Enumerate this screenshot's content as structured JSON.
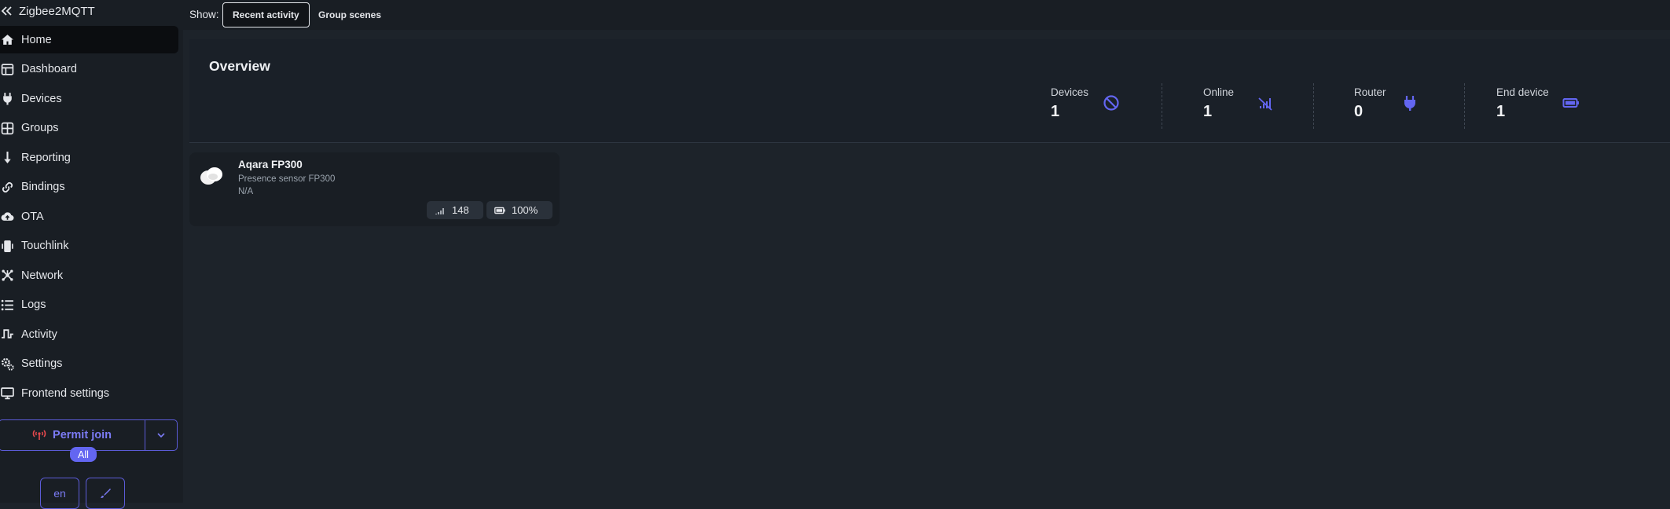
{
  "app": {
    "title": "Zigbee2MQTT"
  },
  "sidebar": {
    "items": [
      {
        "label": "Home",
        "icon": "home-icon",
        "active": true
      },
      {
        "label": "Dashboard",
        "icon": "dashboard-icon"
      },
      {
        "label": "Devices",
        "icon": "plug-icon"
      },
      {
        "label": "Groups",
        "icon": "groups-icon"
      },
      {
        "label": "Reporting",
        "icon": "arrow-down-icon"
      },
      {
        "label": "Bindings",
        "icon": "link-icon"
      },
      {
        "label": "OTA",
        "icon": "cloud-upload-icon"
      },
      {
        "label": "Touchlink",
        "icon": "touchlink-icon"
      },
      {
        "label": "Network",
        "icon": "network-icon"
      },
      {
        "label": "Logs",
        "icon": "list-icon"
      },
      {
        "label": "Activity",
        "icon": "activity-icon"
      },
      {
        "label": "Settings",
        "icon": "gears-icon"
      },
      {
        "label": "Frontend settings",
        "icon": "monitor-icon"
      }
    ],
    "permit_join": {
      "label": "Permit join",
      "badge": "All"
    },
    "language": "en"
  },
  "topbar": {
    "show_label": "Show:",
    "tabs": [
      {
        "label": "Recent activity",
        "selected": true
      },
      {
        "label": "Group scenes",
        "selected": false
      }
    ]
  },
  "overview": {
    "title": "Overview",
    "stats": [
      {
        "label": "Devices",
        "value": "1",
        "icon": "ban-icon"
      },
      {
        "label": "Online",
        "value": "1",
        "icon": "signal-off-icon"
      },
      {
        "label": "Router",
        "value": "0",
        "icon": "plug-icon"
      },
      {
        "label": "End device",
        "value": "1",
        "icon": "battery-icon"
      }
    ]
  },
  "devices": [
    {
      "name": "Aqara FP300",
      "description": "Presence sensor FP300",
      "location": "N/A",
      "lqi": "148",
      "battery": "100%"
    }
  ],
  "colors": {
    "accent": "#6366f1",
    "accent_text": "#7b7bf5",
    "permit_icon": "#e5484d",
    "background": "#1d232a",
    "sidebar": "#191e24"
  }
}
